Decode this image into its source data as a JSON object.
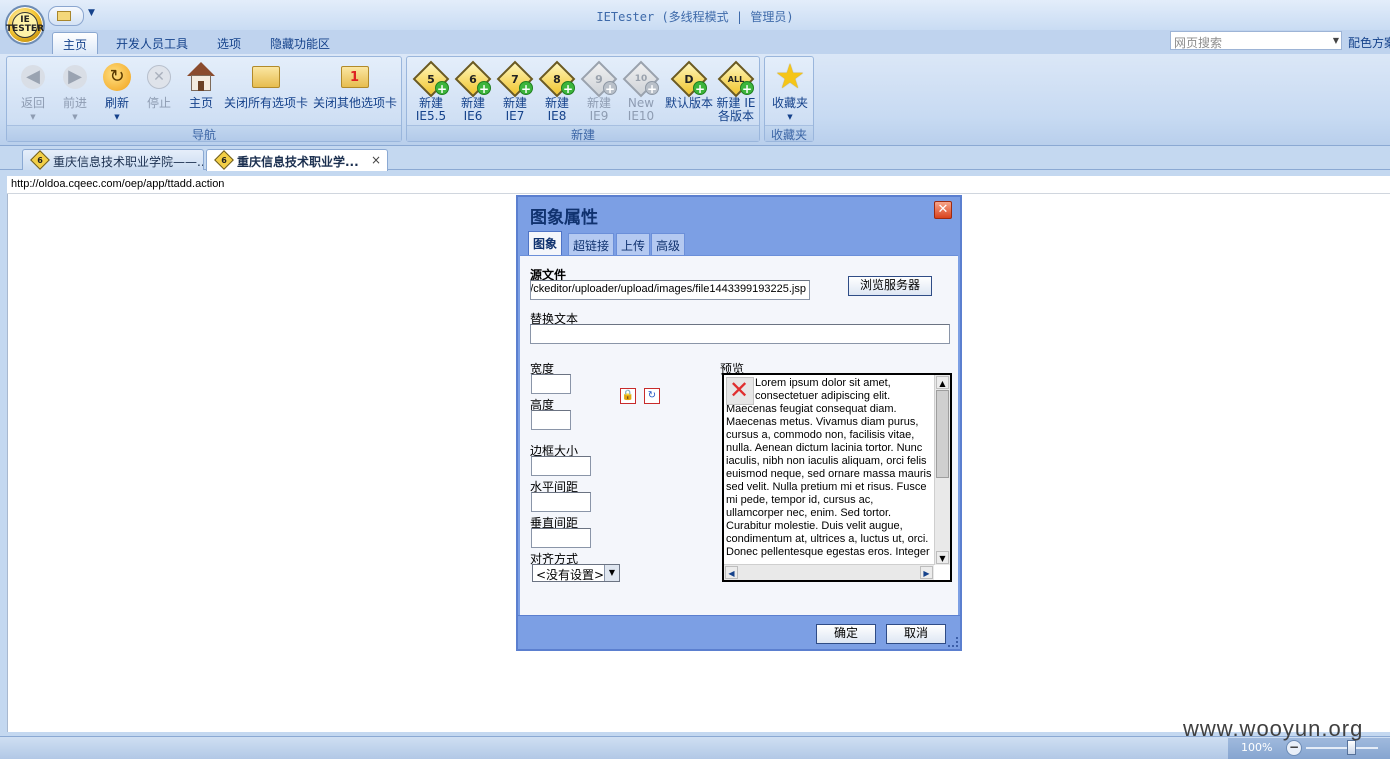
{
  "window": {
    "title": "IETester (多线程模式 | 管理员)",
    "orb_label": "IE TESTER"
  },
  "ribbon_tabs": [
    {
      "label": "主页",
      "active": true
    },
    {
      "label": "开发人员工具",
      "active": false
    },
    {
      "label": "选项",
      "active": false
    },
    {
      "label": "隐藏功能区",
      "active": false
    }
  ],
  "search": {
    "placeholder": "网页搜索"
  },
  "color_scheme_label": "配色方案",
  "groups": {
    "nav": {
      "label": "导航",
      "buttons": {
        "back": "返回",
        "forward": "前进",
        "refresh": "刷新",
        "stop": "停止",
        "home": "主页",
        "close_all": "关闭所有选项卡",
        "close_others": "关闭其他选项卡"
      }
    },
    "new": {
      "label": "新建",
      "buttons": [
        {
          "line1": "新建",
          "line2": "IE5.5",
          "badge": "5",
          "enabled": true
        },
        {
          "line1": "新建",
          "line2": "IE6",
          "badge": "6",
          "enabled": true
        },
        {
          "line1": "新建",
          "line2": "IE7",
          "badge": "7",
          "enabled": true
        },
        {
          "line1": "新建",
          "line2": "IE8",
          "badge": "8",
          "enabled": true
        },
        {
          "line1": "新建",
          "line2": "IE9",
          "badge": "9",
          "enabled": false
        },
        {
          "line1": "New",
          "line2": "IE10",
          "badge": "10",
          "enabled": false
        },
        {
          "line1": "默认版本",
          "line2": "",
          "badge": "D",
          "enabled": true
        },
        {
          "line1": "新建 IE",
          "line2": "各版本",
          "badge": "ALL",
          "enabled": true
        }
      ]
    },
    "favorites": {
      "label": "收藏夹",
      "button": "收藏夹"
    }
  },
  "doc_tabs": [
    {
      "title": "重庆信息技术职业学院——...",
      "badge": "6",
      "active": false
    },
    {
      "title": "重庆信息技术职业学...",
      "badge": "6",
      "active": true,
      "close": "×"
    }
  ],
  "address": "http://oldoa.cqeec.com/oep/app/ttadd.action",
  "dialog": {
    "title": "图象属性",
    "close": "✕",
    "tabs": [
      "图象",
      "超链接",
      "上传",
      "高级"
    ],
    "source_label": "源文件",
    "source_value": "/ckeditor/uploader/upload/images/file1443399193225.jsp",
    "browse_button": "浏览服务器",
    "alt_label": "替换文本",
    "alt_value": "",
    "width_label": "宽度",
    "height_label": "高度",
    "border_label": "边框大小",
    "hspace_label": "水平间距",
    "vspace_label": "垂直间距",
    "align_label": "对齐方式",
    "align_value": "<没有设置>",
    "preview_label": "预览",
    "preview_text": "Lorem ipsum dolor sit amet, consectetuer adipiscing elit. Maecenas feugiat consequat diam. Maecenas metus. Vivamus diam purus, cursus a, commodo non, facilisis vitae, nulla. Aenean dictum lacinia tortor. Nunc iaculis, nibh non iaculis aliquam, orci felis euismod neque, sed ornare massa mauris sed velit. Nulla pretium mi et risus. Fusce mi pede, tempor id, cursus ac, ullamcorper nec, enim. Sed tortor. Curabitur molestie. Duis velit augue, condimentum at, ultrices a, luctus ut, orci. Donec pellentesque egestas eros. Integer",
    "ok_button": "确定",
    "cancel_button": "取消"
  },
  "status": {
    "zoom": "100%",
    "zoom_out": "−"
  },
  "watermark": "www.wooyun.org"
}
